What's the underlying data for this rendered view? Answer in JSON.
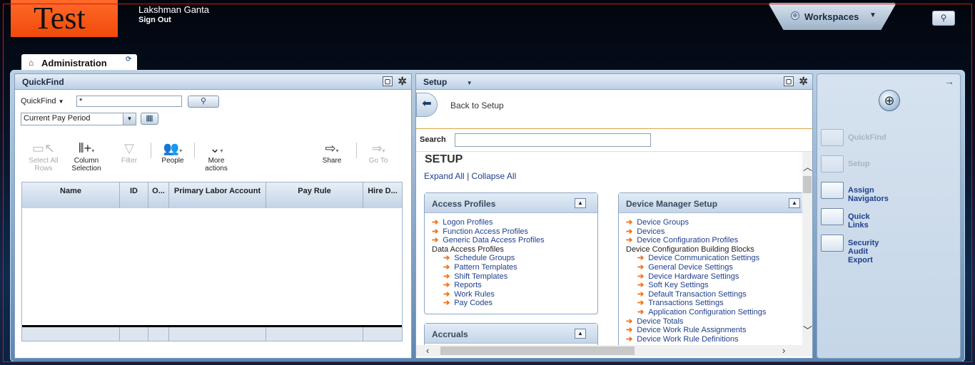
{
  "header": {
    "logo_text": "Test",
    "user_name": "Lakshman Ganta",
    "sign_out": "Sign Out",
    "workspaces_label": "Workspaces"
  },
  "tab": {
    "label": "Administration"
  },
  "quickfind": {
    "panel_title": "QuickFind",
    "search_type": "QuickFind",
    "search_value": "*",
    "period": "Current Pay Period",
    "toolbar": [
      {
        "line1": "Select All",
        "line2": "Rows",
        "enabled": false,
        "icon": "select-all-icon"
      },
      {
        "line1": "Column",
        "line2": "Selection",
        "enabled": true,
        "icon": "column-selection-icon"
      },
      {
        "line1": "Filter",
        "line2": "",
        "enabled": false,
        "icon": "filter-icon"
      },
      {
        "line1": "People",
        "line2": "",
        "enabled": true,
        "icon": "people-icon"
      },
      {
        "line1": "More",
        "line2": "actions",
        "enabled": true,
        "icon": "more-actions-icon"
      },
      {
        "line1": "Share",
        "line2": "",
        "enabled": true,
        "icon": "share-icon"
      },
      {
        "line1": "Go To",
        "line2": "",
        "enabled": false,
        "icon": "go-to-icon"
      }
    ],
    "columns": [
      {
        "label": "Name"
      },
      {
        "label": "ID"
      },
      {
        "label": "O..."
      },
      {
        "label": "Primary Labor Account"
      },
      {
        "label": "Pay Rule"
      },
      {
        "label": "Hire D..."
      }
    ]
  },
  "setup": {
    "panel_title": "Setup",
    "back_label": "Back to Setup",
    "search_label": "Search",
    "search_value": "",
    "heading": "SETUP",
    "expand_all": "Expand All",
    "collapse_all": "Collapse All",
    "separator": "|",
    "access_profiles": {
      "title": "Access Profiles",
      "items": [
        {
          "text": "Logon Profiles",
          "link": true,
          "indent": 0
        },
        {
          "text": "Function Access Profiles",
          "link": true,
          "indent": 0
        },
        {
          "text": "Generic Data Access Profiles",
          "link": true,
          "indent": 0
        },
        {
          "text": "Data Access Profiles",
          "link": false,
          "indent": 0
        },
        {
          "text": "Schedule Groups",
          "link": true,
          "indent": 1
        },
        {
          "text": "Pattern Templates",
          "link": true,
          "indent": 1
        },
        {
          "text": "Shift Templates",
          "link": true,
          "indent": 1
        },
        {
          "text": "Reports",
          "link": true,
          "indent": 1
        },
        {
          "text": "Work Rules",
          "link": true,
          "indent": 1
        },
        {
          "text": "Pay Codes",
          "link": true,
          "indent": 1
        }
      ]
    },
    "accruals": {
      "title": "Accruals"
    },
    "device_manager": {
      "title": "Device Manager Setup",
      "items": [
        {
          "text": "Device Groups",
          "link": true,
          "indent": 0
        },
        {
          "text": "Devices",
          "link": true,
          "indent": 0
        },
        {
          "text": "Device Configuration Profiles",
          "link": true,
          "indent": 0
        },
        {
          "text": "Device Configuration Building Blocks",
          "link": false,
          "indent": 0
        },
        {
          "text": "Device Communication Settings",
          "link": true,
          "indent": 1
        },
        {
          "text": "General Device Settings",
          "link": true,
          "indent": 1
        },
        {
          "text": "Device Hardware Settings",
          "link": true,
          "indent": 1
        },
        {
          "text": "Soft Key Settings",
          "link": true,
          "indent": 1
        },
        {
          "text": "Default Transaction Settings",
          "link": true,
          "indent": 1
        },
        {
          "text": "Transactions Settings",
          "link": true,
          "indent": 1
        },
        {
          "text": "Application Configuration Settings",
          "link": true,
          "indent": 1
        },
        {
          "text": "Device Totals",
          "link": true,
          "indent": 0
        },
        {
          "text": "Device Work Rule Assignments",
          "link": true,
          "indent": 0
        },
        {
          "text": "Device Work Rule Definitions",
          "link": true,
          "indent": 0
        }
      ]
    }
  },
  "navigator": {
    "items": [
      {
        "label": "QuickFind",
        "enabled": false
      },
      {
        "label": "Setup",
        "enabled": false
      },
      {
        "label": "Assign Navigators",
        "enabled": true
      },
      {
        "label": "Quick Links",
        "enabled": true
      },
      {
        "label": "Security Audit Export",
        "enabled": true
      }
    ]
  },
  "colors": {
    "accent_orange": "#f04a0a",
    "link_blue": "#1f3f8c",
    "disabled_text": "#aab4c0",
    "nav_text": "#1f3f8c"
  }
}
